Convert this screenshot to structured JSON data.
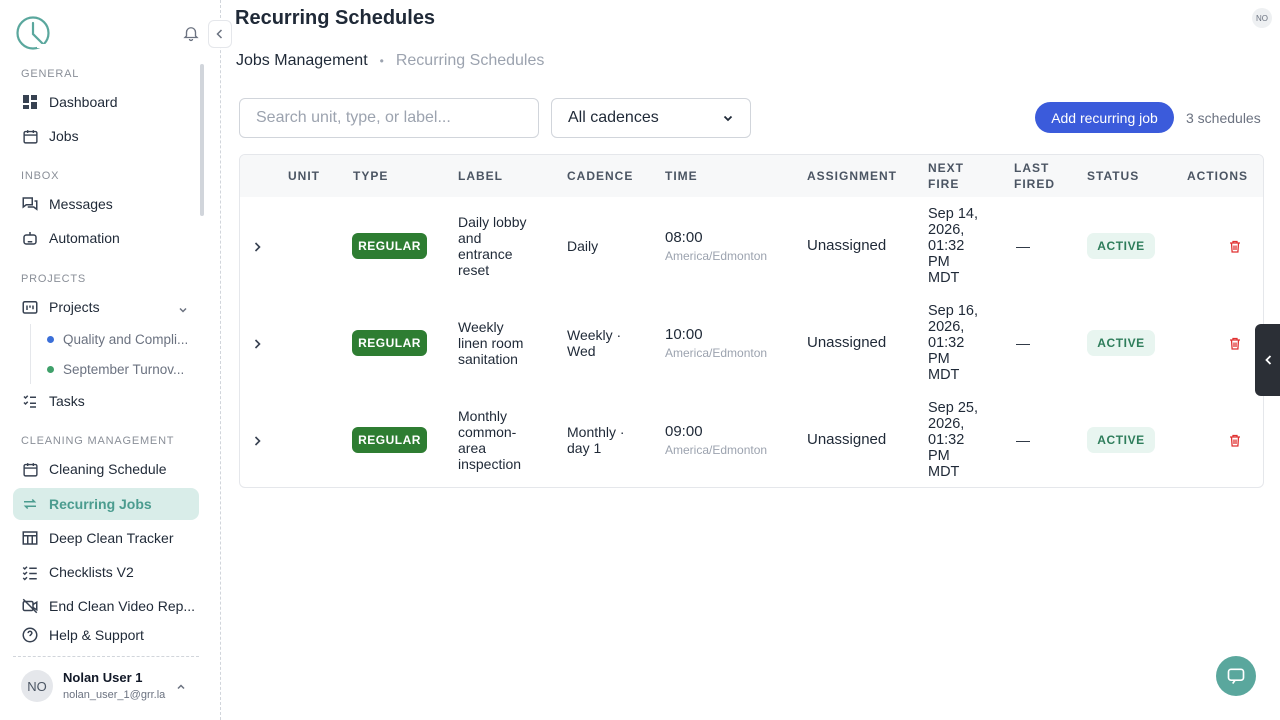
{
  "sidebar": {
    "sections": {
      "general": "GENERAL",
      "inbox": "INBOX",
      "projects": "PROJECTS",
      "cleaning": "CLEANING MANAGEMENT"
    },
    "items": {
      "dashboard": "Dashboard",
      "jobs": "Jobs",
      "messages": "Messages",
      "automation": "Automation",
      "projects": "Projects",
      "project_quality": "Quality and Compli...",
      "project_september": "September Turnov...",
      "tasks": "Tasks",
      "cleaning_schedule": "Cleaning Schedule",
      "recurring_jobs": "Recurring Jobs",
      "deep_clean": "Deep Clean Tracker",
      "checklists": "Checklists V2",
      "end_clean": "End Clean Video Rep...",
      "help": "Help & Support"
    },
    "project_colors": {
      "quality": "#3b6fd8",
      "september": "#3fa06a"
    },
    "user": {
      "initials": "NO",
      "name": "Nolan User 1",
      "email": "nolan_user_1@grr.la"
    }
  },
  "header": {
    "title": "Recurring Schedules",
    "avatar_initials": "NO",
    "breadcrumb": {
      "parent": "Jobs Management",
      "separator": "•",
      "current": "Recurring Schedules"
    }
  },
  "toolbar": {
    "search_placeholder": "Search unit, type, or label...",
    "cadence_filter": "All cadences",
    "add_label": "Add recurring job",
    "count": "3 schedules"
  },
  "table": {
    "headers": {
      "unit": "UNIT",
      "type": "TYPE",
      "label": "LABEL",
      "cadence": "CADENCE",
      "time": "TIME",
      "assignment": "ASSIGNMENT",
      "next_fire_1": "NEXT",
      "next_fire_2": "FIRE",
      "last_fired_1": "LAST",
      "last_fired_2": "FIRED",
      "status": "STATUS",
      "actions": "ACTIONS"
    },
    "rows": [
      {
        "type": "REGULAR",
        "label": [
          "Daily lobby",
          "and",
          "entrance",
          "reset"
        ],
        "cadence": [
          "Daily"
        ],
        "time": "08:00",
        "tz": "America/Edmonton",
        "assignment": "Unassigned",
        "next_fire": [
          "Sep 14,",
          "2026,",
          "01:32",
          "PM",
          "MDT"
        ],
        "last_fired": "—",
        "status": "ACTIVE"
      },
      {
        "type": "REGULAR",
        "label": [
          "Weekly",
          "linen room",
          "sanitation"
        ],
        "cadence": [
          "Weekly ·",
          "Wed"
        ],
        "time": "10:00",
        "tz": "America/Edmonton",
        "assignment": "Unassigned",
        "next_fire": [
          "Sep 16,",
          "2026,",
          "01:32",
          "PM",
          "MDT"
        ],
        "last_fired": "—",
        "status": "ACTIVE"
      },
      {
        "type": "REGULAR",
        "label": [
          "Monthly",
          "common-",
          "area",
          "inspection"
        ],
        "cadence": [
          "Monthly ·",
          "day 1"
        ],
        "time": "09:00",
        "tz": "America/Edmonton",
        "assignment": "Unassigned",
        "next_fire": [
          "Sep 25,",
          "2026,",
          "01:32",
          "PM",
          "MDT"
        ],
        "last_fired": "—",
        "status": "ACTIVE"
      }
    ]
  },
  "colors": {
    "accent": "#4b9c8f",
    "primary_button": "#3b5bdb",
    "regular_badge": "#2e7d32",
    "status_active": "#2e7d5b",
    "delete": "#e03131"
  }
}
